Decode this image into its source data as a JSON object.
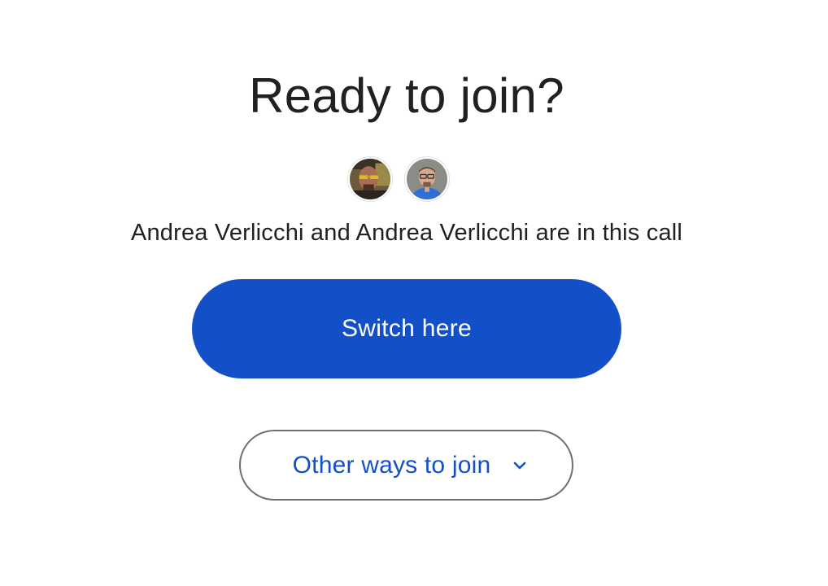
{
  "heading": "Ready to join?",
  "participants": {
    "avatars": [
      {
        "name": "Andrea Verlicchi",
        "icon": "avatar-photo"
      },
      {
        "name": "Andrea Verlicchi",
        "icon": "avatar-photo"
      }
    ],
    "summary": "Andrea Verlicchi and Andrea Verlicchi are in this call"
  },
  "actions": {
    "primary_label": "Switch here",
    "secondary_label": "Other ways to join",
    "secondary_icon": "chevron-down-icon"
  },
  "colors": {
    "primary": "#134fc7",
    "text": "#202124",
    "outline": "#6f6f6f"
  }
}
